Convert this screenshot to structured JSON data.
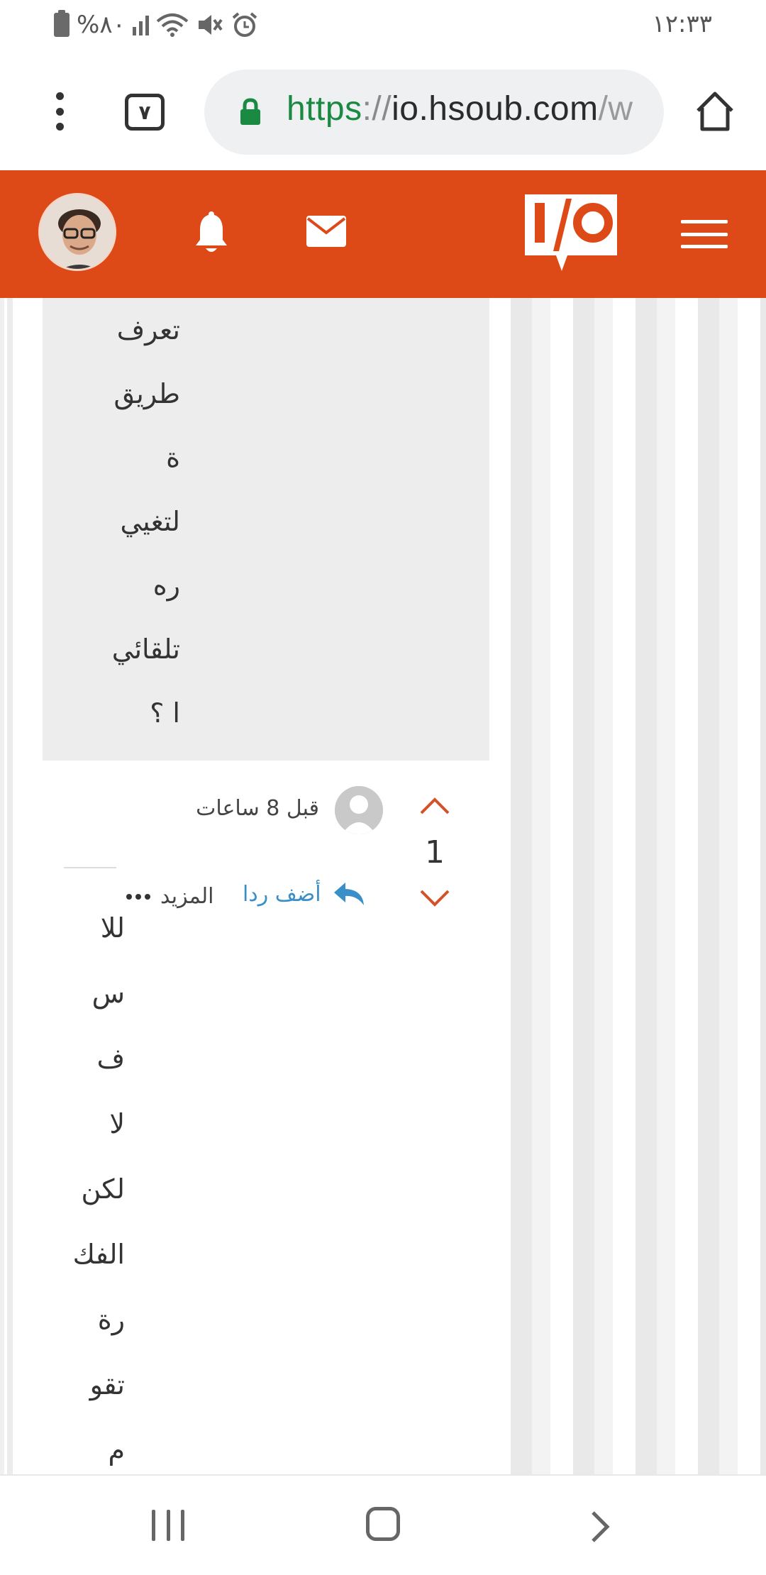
{
  "status_bar": {
    "battery_text": "%٨٠",
    "time": "١٢:٣٣"
  },
  "browser": {
    "tab_count": "٧",
    "url_scheme": "https",
    "url_separator": "://",
    "url_host": "io.hsoub.com",
    "url_path": "/w"
  },
  "site_header": {
    "brand": "I/O",
    "accent_color": "#dd4a18"
  },
  "previous_post": {
    "words": [
      "تعرف",
      "طريق",
      "ة",
      "لتغيي",
      "ره",
      "تلقائي",
      "ا ؟"
    ]
  },
  "comment": {
    "timestamp": "قبل 8 ساعات",
    "vote_count": "1",
    "reply_label": "أضف ردا",
    "more_label": "المزيد",
    "words": [
      "للا",
      "س",
      "ف",
      "لا",
      "لكن",
      "الفك",
      "رة",
      "تقو",
      "م"
    ]
  },
  "icons": {
    "menu": "kebab-menu-icon",
    "lock": "lock-icon",
    "home": "home-icon",
    "notifications": "bell-icon",
    "messages": "mail-icon",
    "hamburger": "hamburger-icon",
    "upvote": "chevron-up-icon",
    "downvote": "chevron-down-icon",
    "reply": "reply-arrow-icon"
  }
}
